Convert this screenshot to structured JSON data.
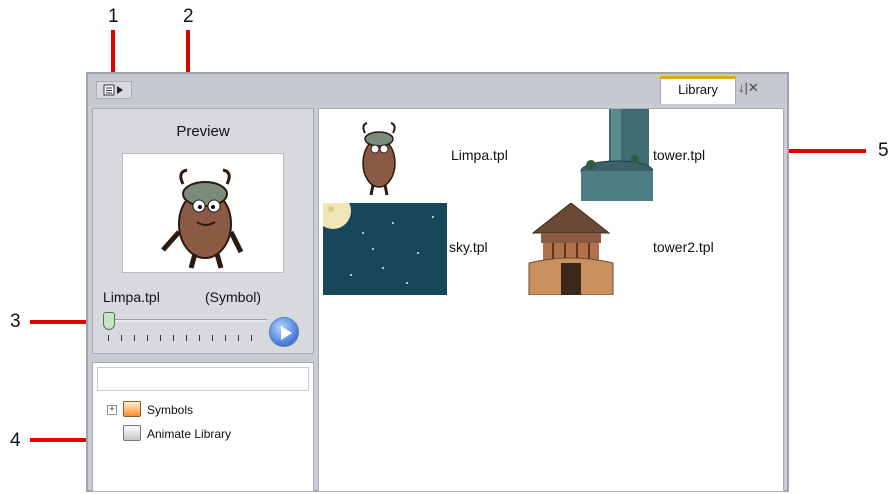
{
  "callouts": [
    "1",
    "2",
    "3",
    "4",
    "5"
  ],
  "window": {
    "tab": "Library",
    "tab_controls": "↓|✕"
  },
  "preview": {
    "title": "Preview",
    "symbol_name": "Limpa.tpl",
    "symbol_type": "(Symbol)",
    "frame_fraction": 0.0
  },
  "tree": {
    "items": [
      {
        "label": "Symbols",
        "icon": "symbols-folder-icon",
        "expandable": true
      },
      {
        "label": "Animate Library",
        "icon": "library-icon",
        "expandable": false
      }
    ]
  },
  "library": {
    "items": [
      {
        "label": "Limpa.tpl",
        "thumb": "character-thumb"
      },
      {
        "label": "tower.tpl",
        "thumb": "tower-thumb"
      },
      {
        "label": "sky.tpl",
        "thumb": "sky-thumb"
      },
      {
        "label": "tower2.tpl",
        "thumb": "gazebo-thumb"
      }
    ]
  },
  "colors": {
    "callout_line": "#e00000",
    "tab_accent": "#e6a21a",
    "sky": "#17485a"
  }
}
